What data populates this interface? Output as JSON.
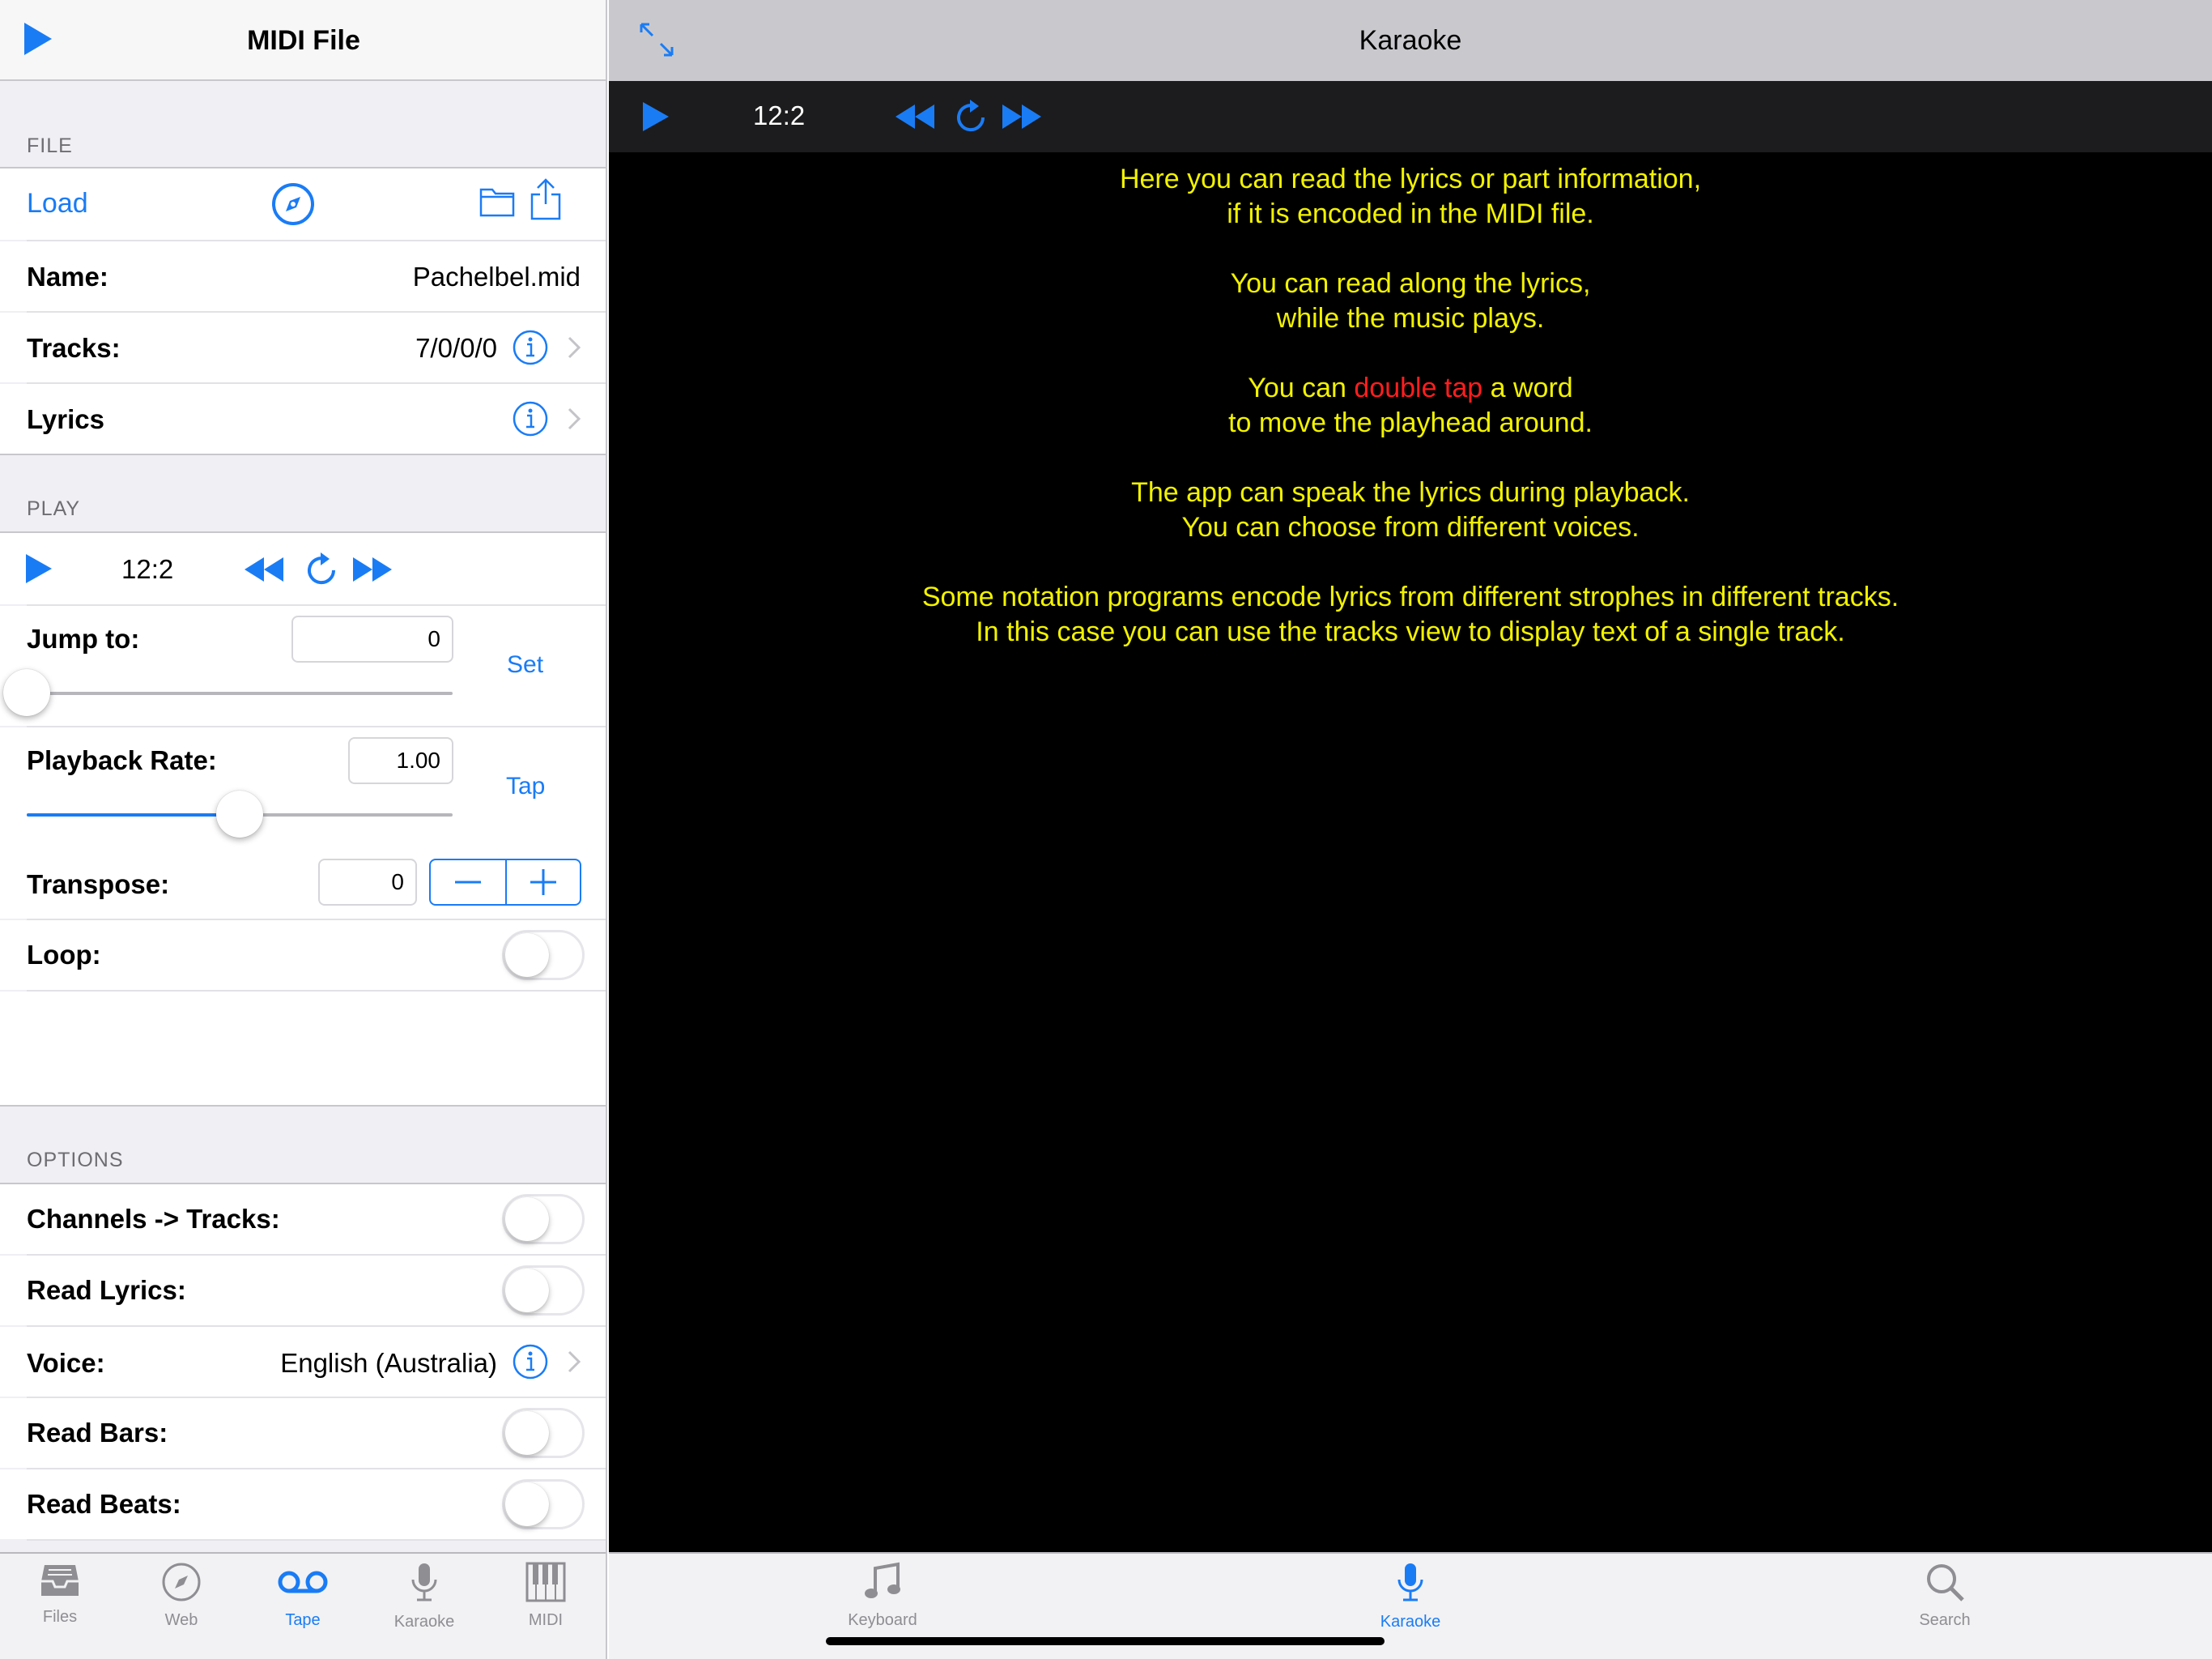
{
  "left_panel": {
    "title": "MIDI File",
    "file_section": {
      "header": "FILE",
      "load_label": "Load",
      "name_label": "Name:",
      "name_value": "Pachelbel.mid",
      "tracks_label": "Tracks:",
      "tracks_value": "7/0/0/0",
      "lyrics_label": "Lyrics"
    },
    "play_section": {
      "header": "PLAY",
      "time": "12:2",
      "jump_label": "Jump to:",
      "jump_value": "0",
      "jump_slider_fraction": 0.0,
      "set_label": "Set",
      "rate_label": "Playback Rate:",
      "rate_value": "1.00",
      "rate_slider_fraction": 0.5,
      "tap_label": "Tap",
      "transpose_label": "Transpose:",
      "transpose_value": "0",
      "loop_label": "Loop:",
      "loop_on": false
    },
    "options_section": {
      "header": "OPTIONS",
      "channels_label": "Channels -> Tracks:",
      "read_lyrics_label": "Read Lyrics:",
      "voice_label": "Voice:",
      "voice_value": "English (Australia)",
      "read_bars_label": "Read Bars:",
      "read_beats_label": "Read Beats:"
    },
    "tabs": [
      {
        "label": "Files",
        "icon": "tray-icon"
      },
      {
        "label": "Web",
        "icon": "compass-icon"
      },
      {
        "label": "Tape",
        "icon": "tape-icon",
        "selected": true
      },
      {
        "label": "Karaoke",
        "icon": "microphone-icon"
      },
      {
        "label": "MIDI",
        "icon": "piano-keys-icon"
      }
    ]
  },
  "right_panel": {
    "title": "Karaoke",
    "time": "12:2",
    "lyrics": {
      "p1_l1": "Here you can read the lyrics or part information,",
      "p1_l2": "if it is encoded in the MIDI file.",
      "p2_l1": "You can read along the lyrics,",
      "p2_l2": "while the music plays.",
      "p3_pre": "You can ",
      "p3_highlight": "double tap",
      "p3_post": " a word",
      "p3_l2": "to move the playhead around.",
      "p4_l1": "The app can speak the lyrics during playback.",
      "p4_l2": "You can choose from different voices.",
      "p5_l1": "Some notation programs encode lyrics from different strophes in different tracks.",
      "p5_l2": "In this case you can use the tracks view to display text of a single track."
    },
    "tabs": [
      {
        "label": "Keyboard",
        "icon": "music-note-icon"
      },
      {
        "label": "Karaoke",
        "icon": "microphone-icon",
        "selected": true
      },
      {
        "label": "Search",
        "icon": "search-icon"
      }
    ]
  },
  "colors": {
    "accent": "#1a7cf5",
    "lyrics_text": "#f2f200",
    "lyrics_highlight": "#ff1e1e",
    "lyrics_background": "#000000"
  }
}
